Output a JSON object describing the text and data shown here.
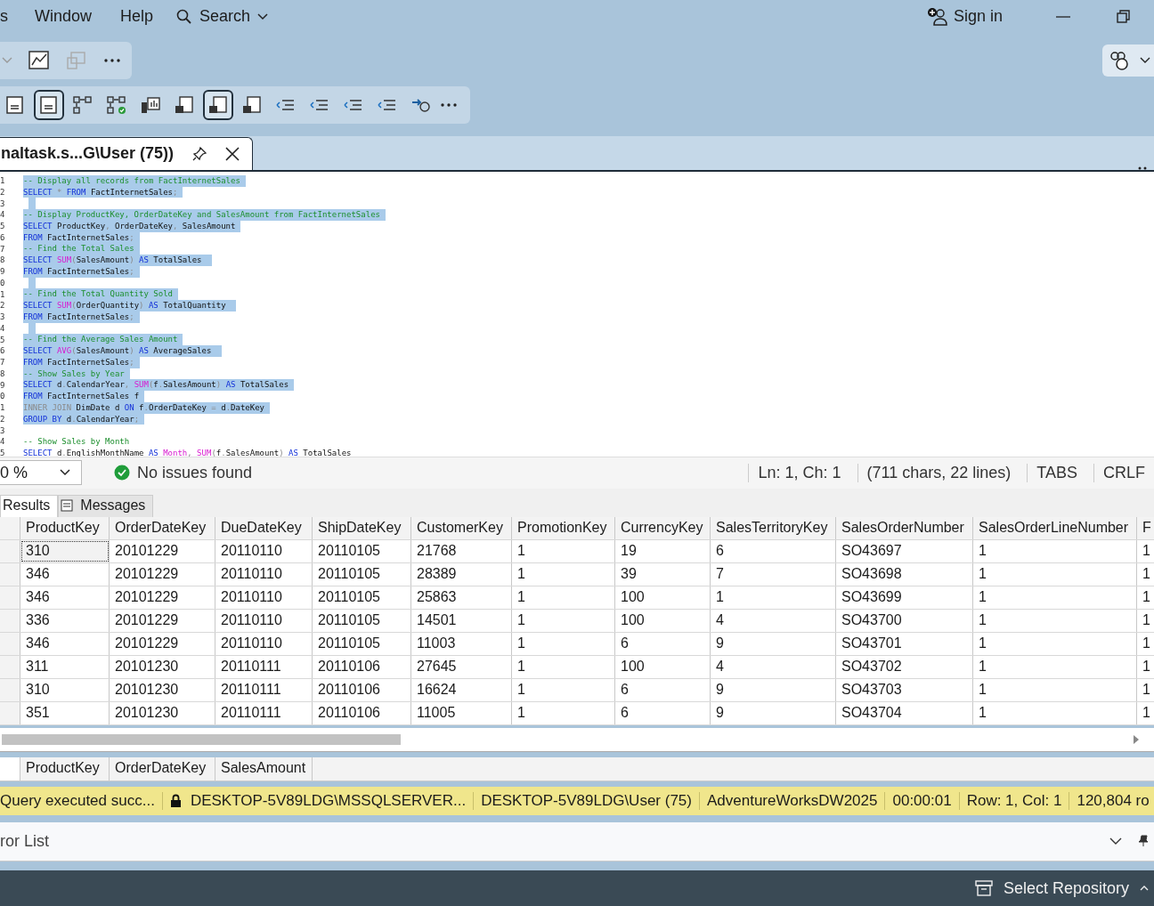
{
  "menu": {
    "items": [
      "s",
      "Window",
      "Help"
    ],
    "search": "Search",
    "sign_in": "Sign in"
  },
  "toolbar_2": {
    "buttons": [
      {
        "pressed": false
      },
      {
        "pressed": true
      },
      {
        "pressed": false
      },
      {
        "pressed": false
      },
      {
        "pressed": false
      },
      {
        "pressed": false
      },
      {
        "pressed": true
      },
      {
        "pressed": false
      },
      {
        "pressed": false
      },
      {
        "pressed": false
      },
      {
        "pressed": false
      },
      {
        "pressed": false
      },
      {
        "pressed": false
      }
    ]
  },
  "document_tab": {
    "title": "naltask.s...G\\User (75))",
    "selected": true
  },
  "editor": {
    "lines": [
      {
        "number": "1",
        "selected": true,
        "tokens": [
          {
            "kind": "comment",
            "text": "-- Display all records from FactInternetSales"
          }
        ]
      },
      {
        "number": "2",
        "selected": true,
        "tokens": [
          {
            "kind": "keyword",
            "text": "SELECT"
          },
          {
            "kind": "op",
            "text": " * "
          },
          {
            "kind": "keyword",
            "text": "FROM"
          },
          {
            "kind": "id",
            "text": " FactInternetSales"
          },
          {
            "kind": "op",
            "text": ";"
          }
        ]
      },
      {
        "number": "3",
        "selected": true
      },
      {
        "number": "4",
        "selected": true,
        "tokens": [
          {
            "kind": "comment",
            "text": "-- Display ProductKey, OrderDateKey and SalesAmount from FactInternetSales"
          }
        ]
      },
      {
        "number": "5",
        "selected": true,
        "tokens": [
          {
            "kind": "keyword",
            "text": "SELECT"
          },
          {
            "kind": "id",
            "text": " ProductKey"
          },
          {
            "kind": "op",
            "text": ", "
          },
          {
            "kind": "id",
            "text": "OrderDateKey"
          },
          {
            "kind": "op",
            "text": ", "
          },
          {
            "kind": "id",
            "text": "SalesAmount"
          }
        ]
      },
      {
        "number": "6",
        "selected": true,
        "tokens": [
          {
            "kind": "keyword",
            "text": "FROM"
          },
          {
            "kind": "id",
            "text": " FactInternetSales"
          },
          {
            "kind": "op",
            "text": ";"
          }
        ]
      },
      {
        "number": "7",
        "selected": true,
        "tokens": [
          {
            "kind": "comment",
            "text": "-- Find the Total Sales"
          }
        ]
      },
      {
        "number": "8",
        "selected": true,
        "tokens": [
          {
            "kind": "keyword",
            "text": "SELECT"
          },
          {
            "kind": "function",
            "text": " SUM"
          },
          {
            "kind": "op",
            "text": "("
          },
          {
            "kind": "id",
            "text": "SalesAmount"
          },
          {
            "kind": "op",
            "text": ") "
          },
          {
            "kind": "keyword",
            "text": "AS"
          },
          {
            "kind": "id",
            "text": " TotalSales "
          }
        ]
      },
      {
        "number": "9",
        "selected": true,
        "tokens": [
          {
            "kind": "keyword",
            "text": "FROM"
          },
          {
            "kind": "id",
            "text": " FactInternetSales"
          },
          {
            "kind": "op",
            "text": ";"
          }
        ]
      },
      {
        "number": "0",
        "selected": true
      },
      {
        "number": "1",
        "selected": true,
        "tokens": [
          {
            "kind": "comment",
            "text": "-- Find the Total Quantity Sold"
          }
        ]
      },
      {
        "number": "2",
        "selected": true,
        "tokens": [
          {
            "kind": "keyword",
            "text": "SELECT"
          },
          {
            "kind": "function",
            "text": " SUM"
          },
          {
            "kind": "op",
            "text": "("
          },
          {
            "kind": "id",
            "text": "OrderQuantity"
          },
          {
            "kind": "op",
            "text": ") "
          },
          {
            "kind": "keyword",
            "text": "AS"
          },
          {
            "kind": "id",
            "text": " TotalQuantity "
          }
        ]
      },
      {
        "number": "3",
        "selected": true,
        "tokens": [
          {
            "kind": "keyword",
            "text": "FROM"
          },
          {
            "kind": "id",
            "text": " FactInternetSales"
          },
          {
            "kind": "op",
            "text": ";"
          }
        ]
      },
      {
        "number": "4",
        "selected": true
      },
      {
        "number": "5",
        "selected": true,
        "tokens": [
          {
            "kind": "comment",
            "text": "-- Find the Average Sales Amount"
          }
        ]
      },
      {
        "number": "6",
        "selected": true,
        "tokens": [
          {
            "kind": "keyword",
            "text": "SELECT"
          },
          {
            "kind": "function",
            "text": " AVG"
          },
          {
            "kind": "op",
            "text": "("
          },
          {
            "kind": "id",
            "text": "SalesAmount"
          },
          {
            "kind": "op",
            "text": ") "
          },
          {
            "kind": "keyword",
            "text": "AS"
          },
          {
            "kind": "id",
            "text": " AverageSales "
          }
        ]
      },
      {
        "number": "7",
        "selected": true,
        "tokens": [
          {
            "kind": "keyword",
            "text": "FROM"
          },
          {
            "kind": "id",
            "text": " FactInternetSales"
          },
          {
            "kind": "op",
            "text": ";"
          }
        ]
      },
      {
        "number": "8",
        "selected": true,
        "tokens": [
          {
            "kind": "comment",
            "text": "-- Show Sales by Year"
          }
        ]
      },
      {
        "number": "9",
        "selected": true,
        "tokens": [
          {
            "kind": "keyword",
            "text": "SELECT"
          },
          {
            "kind": "id",
            "text": " d"
          },
          {
            "kind": "op",
            "text": "."
          },
          {
            "kind": "id",
            "text": "CalendarYear"
          },
          {
            "kind": "op",
            "text": ", "
          },
          {
            "kind": "function",
            "text": "SUM"
          },
          {
            "kind": "op",
            "text": "("
          },
          {
            "kind": "id",
            "text": "f"
          },
          {
            "kind": "op",
            "text": "."
          },
          {
            "kind": "id",
            "text": "SalesAmount"
          },
          {
            "kind": "op",
            "text": ") "
          },
          {
            "kind": "keyword",
            "text": "AS"
          },
          {
            "kind": "id",
            "text": " TotalSales"
          }
        ]
      },
      {
        "number": "0",
        "selected": true,
        "tokens": [
          {
            "kind": "keyword",
            "text": "FROM"
          },
          {
            "kind": "id",
            "text": " FactInternetSales f"
          }
        ]
      },
      {
        "number": "1",
        "selected": true,
        "tokens": [
          {
            "kind": "op",
            "text": "INNER JOIN"
          },
          {
            "kind": "id",
            "text": " DimDate d "
          },
          {
            "kind": "keyword",
            "text": "ON"
          },
          {
            "kind": "id",
            "text": " f"
          },
          {
            "kind": "op",
            "text": "."
          },
          {
            "kind": "id",
            "text": "OrderDateKey "
          },
          {
            "kind": "op",
            "text": "= "
          },
          {
            "kind": "id",
            "text": "d"
          },
          {
            "kind": "op",
            "text": "."
          },
          {
            "kind": "id",
            "text": "DateKey"
          }
        ]
      },
      {
        "number": "2",
        "selected": true,
        "tokens": [
          {
            "kind": "keyword",
            "text": "GROUP BY"
          },
          {
            "kind": "id",
            "text": " d"
          },
          {
            "kind": "op",
            "text": "."
          },
          {
            "kind": "id",
            "text": "CalendarYear"
          },
          {
            "kind": "op",
            "text": ";"
          }
        ]
      },
      {
        "number": "3"
      },
      {
        "number": "4",
        "selected": false,
        "tokens": [
          {
            "kind": "comment",
            "text": "-- Show Sales by Month"
          }
        ]
      },
      {
        "number": "5",
        "selected": false,
        "tokens": [
          {
            "kind": "keyword",
            "text": "SELECT"
          },
          {
            "kind": "id",
            "text": " d"
          },
          {
            "kind": "op",
            "text": "."
          },
          {
            "kind": "id",
            "text": "EnglishMonthName "
          },
          {
            "kind": "keyword",
            "text": "AS"
          },
          {
            "kind": "function",
            "text": " Month"
          },
          {
            "kind": "op",
            "text": ", "
          },
          {
            "kind": "function",
            "text": "SUM"
          },
          {
            "kind": "op",
            "text": "("
          },
          {
            "kind": "id",
            "text": "f"
          },
          {
            "kind": "op",
            "text": "."
          },
          {
            "kind": "id",
            "text": "SalesAmount"
          },
          {
            "kind": "op",
            "text": ") "
          },
          {
            "kind": "keyword",
            "text": "AS"
          },
          {
            "kind": "id",
            "text": " TotalSales"
          }
        ]
      }
    ]
  },
  "editor_status": {
    "zoom": "0 %",
    "issues": "No issues found",
    "position": "Ln: 1, Ch: 1",
    "info": "(711 chars, 22 lines)",
    "indent": "TABS",
    "line_ending": "CRLF"
  },
  "result_tabs": [
    {
      "label": "Results",
      "selected": true
    },
    {
      "label": "Messages",
      "selected": false
    }
  ],
  "grid_1": {
    "columns": [
      "ProductKey",
      "OrderDateKey",
      "DueDateKey",
      "ShipDateKey",
      "CustomerKey",
      "PromotionKey",
      "CurrencyKey",
      "SalesTerritoryKey",
      "SalesOrderNumber",
      "SalesOrderLineNumber",
      "F"
    ],
    "rows": [
      [
        "310",
        "20101229",
        "20110110",
        "20110105",
        "21768",
        "1",
        "19",
        "6",
        "SO43697",
        "1",
        "1"
      ],
      [
        "346",
        "20101229",
        "20110110",
        "20110105",
        "28389",
        "1",
        "39",
        "7",
        "SO43698",
        "1",
        "1"
      ],
      [
        "346",
        "20101229",
        "20110110",
        "20110105",
        "25863",
        "1",
        "100",
        "1",
        "SO43699",
        "1",
        "1"
      ],
      [
        "336",
        "20101229",
        "20110110",
        "20110105",
        "14501",
        "1",
        "100",
        "4",
        "SO43700",
        "1",
        "1"
      ],
      [
        "346",
        "20101229",
        "20110110",
        "20110105",
        "11003",
        "1",
        "6",
        "9",
        "SO43701",
        "1",
        "1"
      ],
      [
        "311",
        "20101230",
        "20110111",
        "20110106",
        "27645",
        "1",
        "100",
        "4",
        "SO43702",
        "1",
        "1"
      ],
      [
        "310",
        "20101230",
        "20110111",
        "20110106",
        "16624",
        "1",
        "6",
        "9",
        "SO43703",
        "1",
        "1"
      ],
      [
        "351",
        "20101230",
        "20110111",
        "20110106",
        "11005",
        "1",
        "6",
        "9",
        "SO43704",
        "1",
        "1"
      ]
    ]
  },
  "grid_2": {
    "columns": [
      "ProductKey",
      "OrderDateKey",
      "SalesAmount"
    ]
  },
  "query_status": [
    "Query  executed  succ...",
    "DESKTOP-5V89LDG\\MSSQLSERVER...",
    "DESKTOP-5V89LDG\\User (75)",
    "AdventureWorksDW2025",
    "00:00:01",
    "Row: 1, Col: 1",
    "120,804 ro"
  ],
  "error_list": {
    "title": "ror List"
  },
  "status_bar": {
    "repository": "Select Repository"
  }
}
